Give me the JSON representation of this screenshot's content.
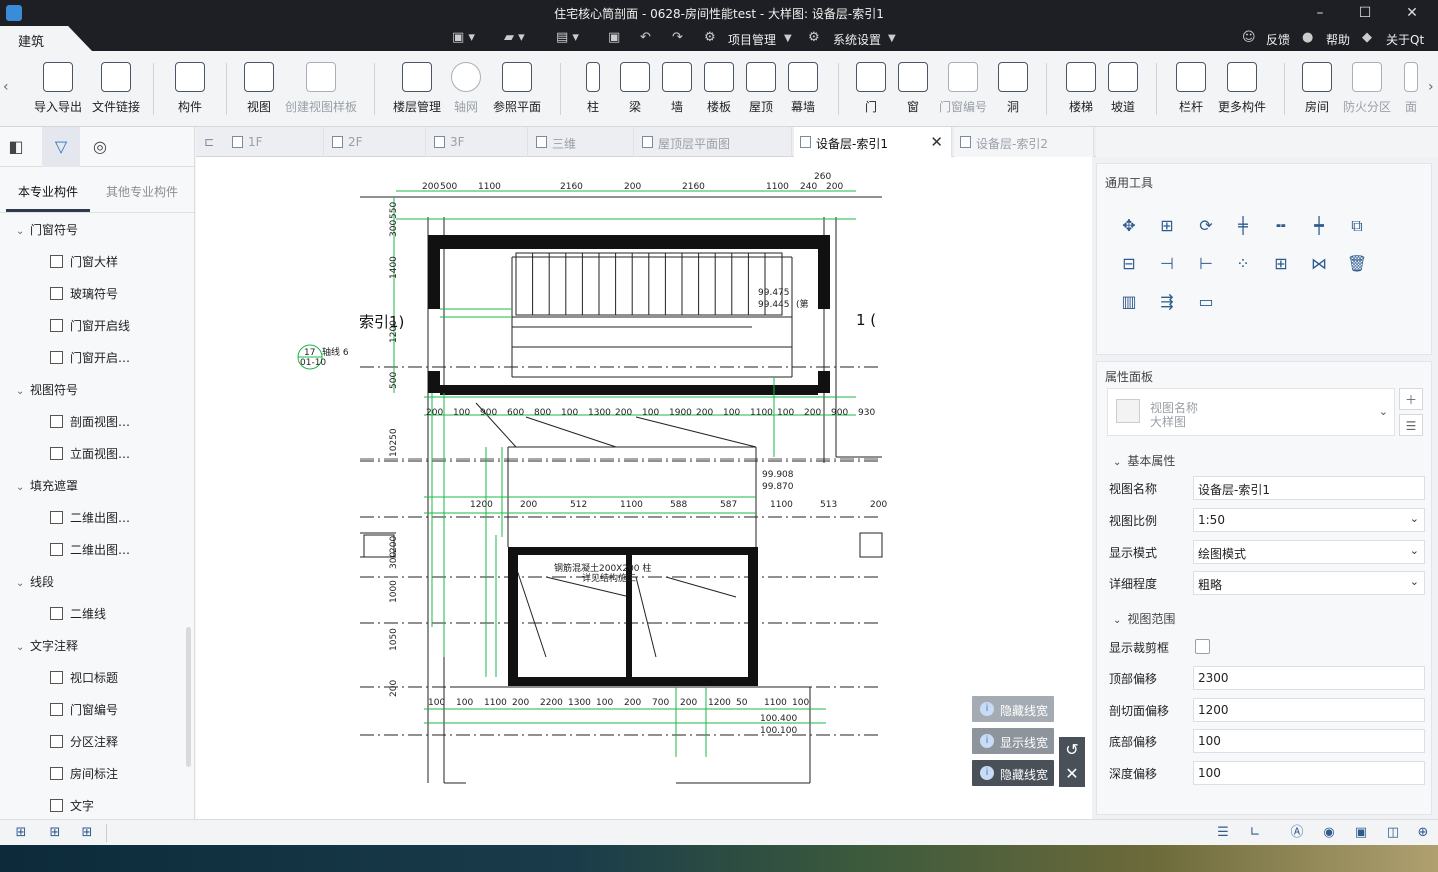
{
  "window": {
    "title": "住宅核心筒剖面 - 0628-房间性能test - 大样图: 设备层-索引1",
    "controls": [
      "–",
      "☐",
      "✕"
    ]
  },
  "menubar": {
    "active_tab": "建筑",
    "project_mgmt": "项目管理",
    "system_settings": "系统设置",
    "feedback": "反馈",
    "help": "帮助",
    "about": "关于Qt"
  },
  "ribbon": {
    "buttons": [
      {
        "label": "导入导出",
        "icon": "cad-icon"
      },
      {
        "label": "文件链接",
        "icon": "file-link-icon"
      },
      {
        "label": "构件",
        "icon": "component-icon"
      },
      {
        "label": "视图",
        "icon": "view-icon"
      },
      {
        "label": "创建视图样板",
        "icon": "view-template-icon",
        "disabled": true
      },
      {
        "label": "楼层管理",
        "icon": "floor-mgmt-icon"
      },
      {
        "label": "轴网",
        "icon": "grid-axis-icon",
        "disabled": true
      },
      {
        "label": "参照平面",
        "icon": "ref-plane-icon"
      },
      {
        "label": "柱",
        "icon": "column-icon"
      },
      {
        "label": "梁",
        "icon": "beam-icon"
      },
      {
        "label": "墙",
        "icon": "wall-icon"
      },
      {
        "label": "楼板",
        "icon": "slab-icon"
      },
      {
        "label": "屋顶",
        "icon": "roof-icon"
      },
      {
        "label": "幕墙",
        "icon": "curtain-wall-icon"
      },
      {
        "label": "门",
        "icon": "door-icon"
      },
      {
        "label": "窗",
        "icon": "window-icon"
      },
      {
        "label": "门窗编号",
        "icon": "door-window-tag-icon",
        "disabled": true
      },
      {
        "label": "洞",
        "icon": "opening-icon"
      },
      {
        "label": "楼梯",
        "icon": "stair-icon"
      },
      {
        "label": "坡道",
        "icon": "ramp-icon"
      },
      {
        "label": "栏杆",
        "icon": "railing-icon"
      },
      {
        "label": "更多构件",
        "icon": "more-components-icon"
      },
      {
        "label": "房间",
        "icon": "room-icon"
      },
      {
        "label": "防火分区",
        "icon": "fire-zone-icon",
        "disabled": true
      },
      {
        "label": "面",
        "icon": "face-icon",
        "disabled": true
      }
    ]
  },
  "leftpanel": {
    "tabs": [
      "本专业构件",
      "其他专业构件"
    ],
    "tree": [
      {
        "label": "门窗符号",
        "children": [
          "门窗大样",
          "玻璃符号",
          "门窗开启线",
          "门窗开启…"
        ]
      },
      {
        "label": "视图符号",
        "children": [
          "剖面视图…",
          "立面视图…"
        ]
      },
      {
        "label": "填充遮罩",
        "children": [
          "二维出图…",
          "二维出图…"
        ]
      },
      {
        "label": "线段",
        "children": [
          "二维线"
        ]
      },
      {
        "label": "文字注释",
        "children": [
          "视口标题",
          "门窗编号",
          "分区注释",
          "房间标注",
          "文字"
        ]
      }
    ]
  },
  "doctabs": [
    {
      "label": "1F"
    },
    {
      "label": "2F"
    },
    {
      "label": "3F"
    },
    {
      "label": "三维"
    },
    {
      "label": "屋顶层平面图"
    },
    {
      "label": "设备层-索引1",
      "active": true
    },
    {
      "label": "设备层-索引2"
    }
  ],
  "canvas": {
    "dims_top": [
      "200",
      "500",
      "1100",
      "2160",
      "200",
      "2160",
      "1100",
      "240",
      "200",
      "260"
    ],
    "dims_left": [
      "550",
      "300",
      "1400",
      "1200",
      "500",
      "10250",
      "1000",
      "300",
      "200",
      "1050",
      "200"
    ],
    "dims_mid1": [
      "200",
      "100",
      "900",
      "600",
      "800",
      "100",
      "1300",
      "200",
      "100",
      "1900",
      "200",
      "100",
      "1100",
      "100",
      "200",
      "900",
      "930"
    ],
    "dims_mid2": [
      "1200",
      "200",
      "512",
      "1100",
      "588",
      "587",
      "1100",
      "513",
      "200"
    ],
    "dims_bottom": [
      "100",
      "100",
      "1100",
      "200",
      "2200",
      "1300",
      "100",
      "200",
      "700",
      "200",
      "1200",
      "50",
      "1100",
      "100"
    ],
    "levels": [
      "99.475",
      "99.445",
      "99.908",
      "99.870",
      "100.400",
      "100.100"
    ],
    "level_suffix": "(第",
    "section_left": "索引1)",
    "section_right": "1 (",
    "grid_bubble": [
      "17",
      "01-10"
    ],
    "grid_tag": "轴线 6",
    "note": "钢筋混凝土200X200 柱",
    "note2": "详见结构施工",
    "overlay_buttons": [
      "隐藏线宽",
      "显示线宽",
      "隐藏线宽"
    ]
  },
  "tools_panel": {
    "title": "通用工具",
    "icons": [
      "move-icon",
      "copy-icon",
      "rotate-icon",
      "align-icon",
      "split-icon",
      "trim-icon",
      "offset-icon",
      "align-left-icon",
      "extend-icon",
      "extend2-icon",
      "array-icon",
      "array-grid-icon",
      "mirror-icon",
      "delete-icon",
      "3d-view-icon",
      "measure-icon",
      "ruler-icon"
    ]
  },
  "properties": {
    "title": "属性面板",
    "type_selector": {
      "line1": "视图名称",
      "line2": "大样图"
    },
    "section_basic": "基本属性",
    "section_range": "视图范围",
    "rows_basic": [
      {
        "label": "视图名称",
        "value": "设备层-索引1"
      },
      {
        "label": "视图比例",
        "value": "1:50",
        "dropdown": true
      },
      {
        "label": "显示模式",
        "value": "绘图模式",
        "dropdown": true
      },
      {
        "label": "详细程度",
        "value": "粗略",
        "dropdown": true
      }
    ],
    "crop_label": "显示裁剪框",
    "rows_range": [
      {
        "label": "顶部偏移",
        "value": "2300"
      },
      {
        "label": "剖切面偏移",
        "value": "1200"
      },
      {
        "label": "底部偏移",
        "value": "100"
      },
      {
        "label": "深度偏移",
        "value": "100"
      }
    ]
  },
  "colors": {
    "accent": "#2f5b8e",
    "drawing_green": "#19b84a",
    "drawing_black": "#111111",
    "titlebar": "#1d1f24"
  }
}
